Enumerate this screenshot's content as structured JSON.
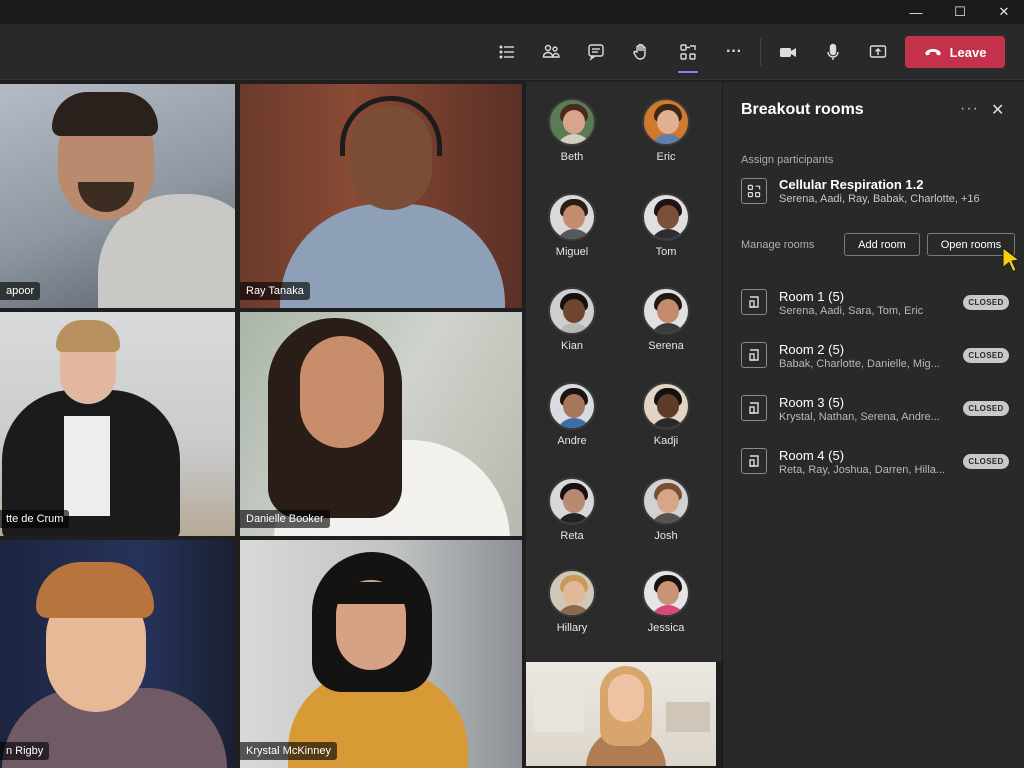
{
  "window": {
    "minimize": "—",
    "maximize": "☐",
    "close": "✕"
  },
  "toolbar": {
    "icons": [
      "list-icon",
      "people-icon",
      "chat-icon",
      "raise-hand-icon",
      "breakout-rooms-icon",
      "more-icon",
      "camera-icon",
      "mic-icon",
      "share-icon"
    ],
    "more_label": "···",
    "leave_label": "Leave",
    "leave_color": "#c4314b"
  },
  "grid": {
    "tiles": [
      {
        "name": "apoor"
      },
      {
        "name": "Ray Tanaka"
      },
      {
        "name": "tte de Crum"
      },
      {
        "name": "Danielle Booker"
      },
      {
        "name": "n Rigby"
      },
      {
        "name": "Krystal McKinney"
      }
    ]
  },
  "participants": [
    {
      "name": "Beth"
    },
    {
      "name": "Eric"
    },
    {
      "name": "Miguel"
    },
    {
      "name": "Tom"
    },
    {
      "name": "Kian"
    },
    {
      "name": "Serena"
    },
    {
      "name": "Andre"
    },
    {
      "name": "Kadji"
    },
    {
      "name": "Reta"
    },
    {
      "name": "Josh"
    },
    {
      "name": "Hillary"
    },
    {
      "name": "Jessica"
    }
  ],
  "panel": {
    "title": "Breakout rooms",
    "more": "···",
    "close": "✕",
    "assign_label": "Assign participants",
    "assign_title": "Cellular Respiration 1.2",
    "assign_sub": "Serena, Aadi, Ray, Babak, Charlotte, +16",
    "manage_label": "Manage rooms",
    "add_room": "Add room",
    "open_rooms": "Open rooms",
    "rooms": [
      {
        "name": "Room 1 (5)",
        "members": "Serena, Aadi, Sara, Tom, Eric",
        "status": "CLOSED"
      },
      {
        "name": "Room 2 (5)",
        "members": "Babak, Charlotte, Danielle, Mig...",
        "status": "CLOSED"
      },
      {
        "name": "Room 3 (5)",
        "members": "Krystal, Nathan, Serena, Andre...",
        "status": "CLOSED"
      },
      {
        "name": "Room 4 (5)",
        "members": "Reta, Ray, Joshua, Darren, Hilla...",
        "status": "CLOSED"
      }
    ]
  }
}
